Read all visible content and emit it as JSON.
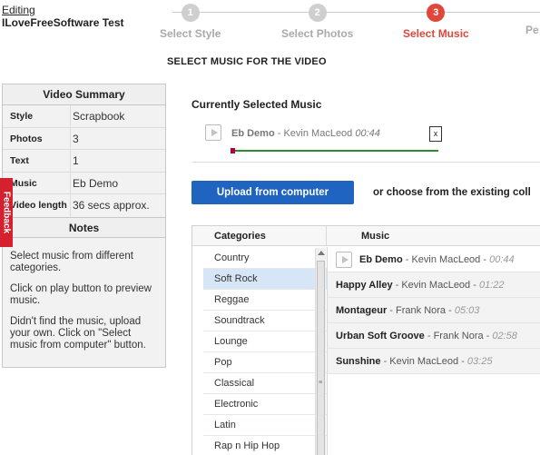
{
  "header": {
    "editing_label": "Editing",
    "project_title": "ILoveFreeSoftware Test"
  },
  "steps": [
    {
      "number": "1",
      "label": "Select Style",
      "state": "done"
    },
    {
      "number": "2",
      "label": "Select Photos",
      "state": "done"
    },
    {
      "number": "3",
      "label": "Select Music",
      "state": "active"
    },
    {
      "number": "",
      "label": "Pe",
      "state": "pending"
    }
  ],
  "page_heading": "SELECT MUSIC FOR THE VIDEO",
  "summary": {
    "title": "Video Summary",
    "rows": [
      {
        "key": "Style",
        "value": "Scrapbook"
      },
      {
        "key": "Photos",
        "value": "3"
      },
      {
        "key": "Text",
        "value": "1"
      },
      {
        "key": "Music",
        "value": "Eb Demo"
      },
      {
        "key": "Video length",
        "value": "36 secs approx."
      }
    ]
  },
  "notes": {
    "title": "Notes",
    "items": [
      "Select music from different categories.",
      "Click on play button to preview music.",
      "Didn't find the music, upload your own. Click on \"Select music from computer\" button."
    ]
  },
  "feedback_tab": "Feedback",
  "current_music": {
    "label": "Currently Selected Music",
    "title": "Eb Demo",
    "separator": " - ",
    "artist": "Kevin MacLeod",
    "duration": "00:44",
    "remove_label": "x",
    "progress": 0.0
  },
  "upload_button": "Upload from computer",
  "or_choose_text": "or choose from the existing coll",
  "browser": {
    "categories_header": "Categories",
    "music_header": "Music",
    "categories": [
      "Country",
      "Soft Rock",
      "Reggae",
      "Soundtrack",
      "Lounge",
      "Pop",
      "Classical",
      "Electronic",
      "Latin",
      "Rap n Hip Hop"
    ],
    "selected_category": "Soft Rock",
    "tracks": [
      {
        "title": "Eb Demo",
        "artist": "Kevin MacLeod",
        "duration": "00:44"
      },
      {
        "title": "Happy Alley",
        "artist": "Kevin MacLeod",
        "duration": "01:22"
      },
      {
        "title": "Montageur",
        "artist": "Frank Nora",
        "duration": "05:03"
      },
      {
        "title": "Urban Soft Groove",
        "artist": "Frank Nora",
        "duration": "02:58"
      },
      {
        "title": "Sunshine",
        "artist": "Kevin MacLeod",
        "duration": "03:25"
      }
    ],
    "separator": " - "
  },
  "colors": {
    "accent_red": "#e0473a",
    "upload_blue": "#1f64c1",
    "progress_green": "#2e8b2e",
    "feedback_red": "#d4202f"
  }
}
